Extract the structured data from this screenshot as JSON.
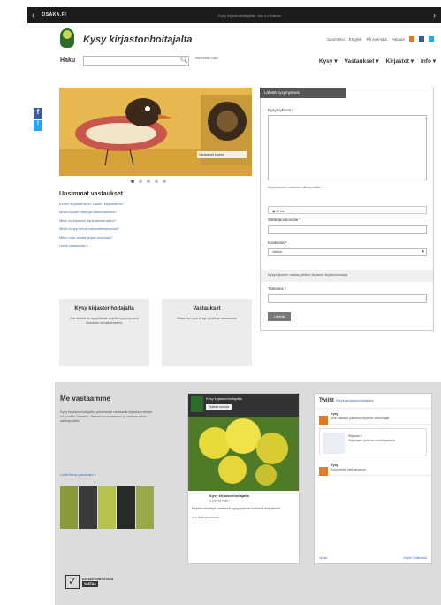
{
  "topbar": {
    "brand": "OSAKA.FI",
    "message": "Kysy kirjastonhoitajalta · Ask a Librarian"
  },
  "header": {
    "site_title": "Kysy kirjastonhoitajalta",
    "links": [
      "Suomeksi",
      "English",
      "På svenska",
      "Palaute"
    ]
  },
  "search": {
    "label": "Haku",
    "advanced": "Tarkennettu haku"
  },
  "nav": [
    "Kysy",
    "Vastaukset",
    "Kirjastot",
    "Info"
  ],
  "slider": {
    "caption": "Vastaukset kuvina"
  },
  "latest": {
    "title": "Uusimmat vastaukset",
    "items": [
      "Kenen kirjoittama on Lasten kirjastolehti?",
      "Mistä löydän vanhoja sanomalehtiä?",
      "Mikä on kirjaston kaukolainamaksu?",
      "Mistä löytyy tietoa sukututkimuksesta?",
      "Miten voin varata kirjan verkossa?"
    ],
    "more": "Lisää vastauksia »"
  },
  "boxes": [
    {
      "title": "Kysy kirjastonhoitajalta",
      "text": "Jos sinulla on kysyttävää, kirjoita kysymyksesi oheiseen lomakkeeseen."
    },
    {
      "title": "Vastaukset",
      "text": "Selaa aiempia kysymyksiä ja vastauksia."
    }
  ],
  "form": {
    "tab": "Lähetä kysymyksesi",
    "question_label": "Kysymyksesi *",
    "hint": "Kysymykseen vastataan sähköpostitse.",
    "radio": "Ei ole",
    "email_label": "Sähköpostiosoite *",
    "municipality_label": "Kotikunta *",
    "municipality_value": "Valitse",
    "gray_note": "Kysymykseen vastaa yleisen kirjaston kirjastonhoitaja.",
    "code_label": "Tarkistus *",
    "send": "Lähetä"
  },
  "band": {
    "title": "Me vastaamme",
    "text": "Kysy kirjastonhoitajalta -palvelussa vastaavat kirjastonhoitajat eri puolilta Suomea. Palvelu on maksuton ja vastaus tulee sähköpostiisi.",
    "link": "Lisää tietoa palvelusta »",
    "badge_top": "KIRJASTONHOITAJA",
    "badge_bottom": "VASTAA"
  },
  "facebook": {
    "page_title": "Kysy kirjastonhoitajalta",
    "like": "Tykkää sivusta",
    "post_name": "Kysy kirjastonhoitajalta",
    "post_date": "3 päivää sitten",
    "post_text": "Kirjastonhoitajat vastaavat kysymyksiisi kaikkina arkipäivinä.",
    "post_link": "Lue lisää palvelusta"
  },
  "twitter": {
    "title": "Twiitit",
    "handle": "@kysykirjastonhoitajalta",
    "tweets": [
      {
        "name": "Kysy",
        "text": "Uusi vastaus julkaistu: kirjaston aukioloajat."
      },
      {
        "name": "Kysy",
        "text": "Kysy meiltä mitä tahansa!"
      }
    ],
    "card_title": "Kirjastot.fi",
    "card_text": "Kirjastojen yhteinen verkkopalvelu",
    "footer_left": "Upota",
    "footer_right": "Näytä Twitterissä"
  },
  "colors": {
    "topbar": "#1c1c1c",
    "brand_green": "#2e6b2f",
    "link": "#4a6fa5",
    "band": "#dcdcdc",
    "facebook": "#3b5998",
    "twitter": "#2aa3ef",
    "rss": "#e07b1f"
  }
}
